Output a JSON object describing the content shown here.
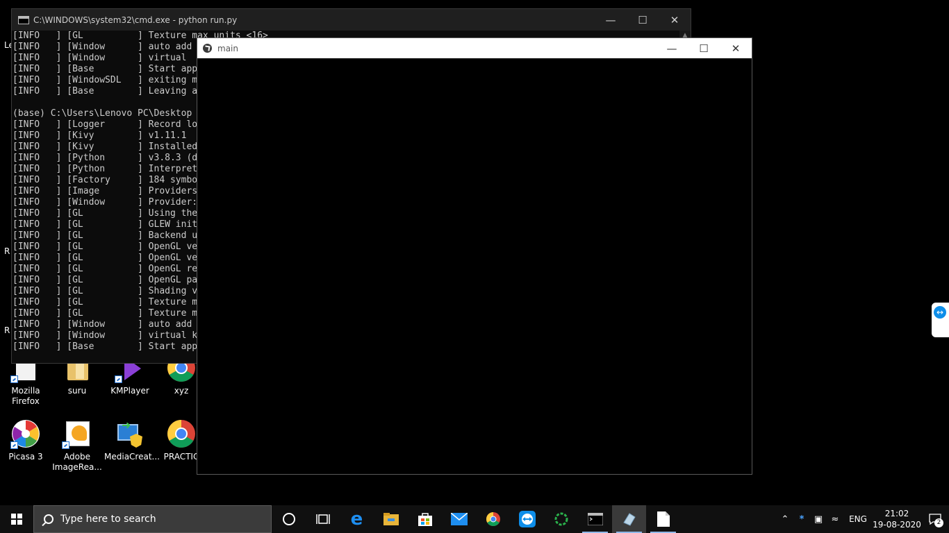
{
  "desktop": {
    "edge_labels": [
      "Le",
      "R",
      "R"
    ],
    "icons_row1": [
      {
        "label": "Mozilla Firefox",
        "icon": "file-icon"
      },
      {
        "label": "suru",
        "icon": "folder-icon"
      },
      {
        "label": "KMPlayer",
        "icon": "kmplayer-icon"
      },
      {
        "label": "xyz",
        "icon": "chrome-icon"
      }
    ],
    "icons_row2": [
      {
        "label": "Picasa 3",
        "icon": "picasa-icon"
      },
      {
        "label": "Adobe ImageRea...",
        "icon": "adobe-imageready-icon"
      },
      {
        "label": "MediaCreat...",
        "icon": "media-creation-icon"
      },
      {
        "label": "PRACTIC",
        "icon": "chrome-icon"
      }
    ]
  },
  "cmd": {
    "title": "C:\\WINDOWS\\system32\\cmd.exe - python  run.py",
    "lines": [
      "[INFO   ] [GL          ] Texture max units <16>",
      "[INFO   ] [Window      ] auto add",
      "[INFO   ] [Window      ] virtual",
      "[INFO   ] [Base        ] Start app",
      "[INFO   ] [WindowSDL   ] exiting m",
      "[INFO   ] [Base        ] Leaving a",
      "",
      "(base) C:\\Users\\Lenovo PC\\Desktop",
      "[INFO   ] [Logger      ] Record lo",
      "[INFO   ] [Kivy        ] v1.11.1",
      "[INFO   ] [Kivy        ] Installed",
      "[INFO   ] [Python      ] v3.8.3 (d",
      "[INFO   ] [Python      ] Interpret",
      "[INFO   ] [Factory     ] 184 symbo",
      "[INFO   ] [Image       ] Providers",
      "[INFO   ] [Window      ] Provider:",
      "[INFO   ] [GL          ] Using the",
      "[INFO   ] [GL          ] GLEW init",
      "[INFO   ] [GL          ] Backend u",
      "[INFO   ] [GL          ] OpenGL ve",
      "[INFO   ] [GL          ] OpenGL ve",
      "[INFO   ] [GL          ] OpenGL re",
      "[INFO   ] [GL          ] OpenGL pa",
      "[INFO   ] [GL          ] Shading v",
      "[INFO   ] [GL          ] Texture m",
      "[INFO   ] [GL          ] Texture m",
      "[INFO   ] [Window      ] auto add",
      "[INFO   ] [Window      ] virtual k",
      "[INFO   ] [Base        ] Start app"
    ],
    "buttons": {
      "minimize": "—",
      "maximize": "☐",
      "close": "✕"
    }
  },
  "kivy": {
    "title": "main",
    "buttons": {
      "minimize": "—",
      "maximize": "☐",
      "close": "✕"
    }
  },
  "taskbar": {
    "search_placeholder": "Type here to search",
    "pinned": [
      {
        "name": "cortana-icon"
      },
      {
        "name": "task-view-icon"
      },
      {
        "name": "edge-icon"
      },
      {
        "name": "file-explorer-icon"
      },
      {
        "name": "store-icon"
      },
      {
        "name": "mail-icon"
      },
      {
        "name": "chrome-icon"
      },
      {
        "name": "teamviewer-icon"
      },
      {
        "name": "loading-ring-icon"
      },
      {
        "name": "cmd-icon"
      },
      {
        "name": "kivy-app-icon"
      },
      {
        "name": "notepad-icon"
      }
    ],
    "tray": {
      "language": "ENG",
      "time": "21:02",
      "date": "19-08-2020",
      "notification_count": "2"
    }
  },
  "colors": {
    "taskbar_bg": "#101010",
    "search_bg": "#3b3b3b",
    "cmd_titlebar": "#1f1f1f",
    "kivy_titlebar": "#ffffff",
    "accent_blue": "#0e8ee9"
  }
}
